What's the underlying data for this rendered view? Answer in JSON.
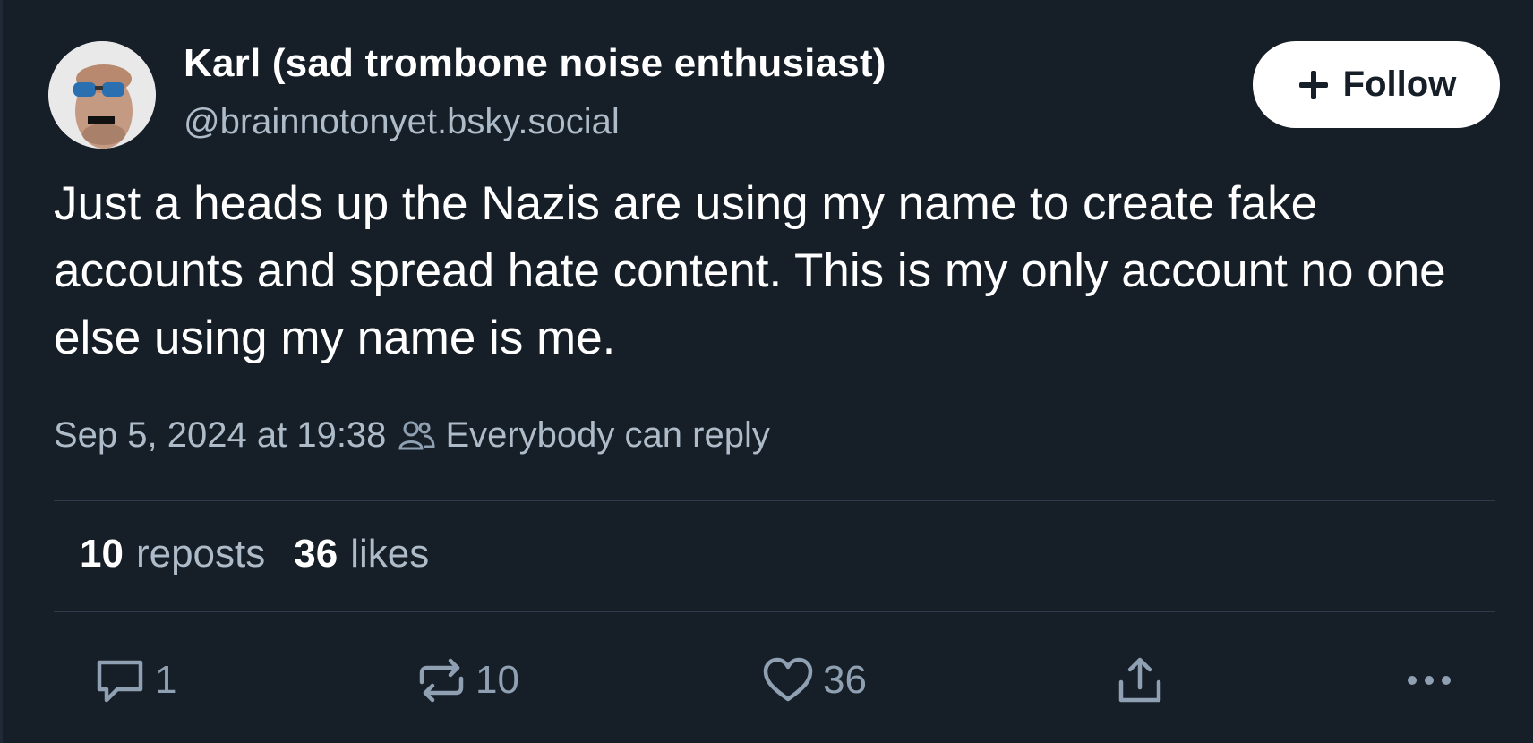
{
  "author": {
    "display_name": "Karl (sad trombone noise enthusiast)",
    "handle": "@brainnotonyet.bsky.social"
  },
  "follow_button": {
    "label": "Follow"
  },
  "post": {
    "text": "Just a heads up the Nazis are using my name to create fake accounts and spread hate content. This is my only account no one else using my name is me.",
    "timestamp": "Sep 5, 2024 at 19:38",
    "reply_setting": "Everybody can reply"
  },
  "stats": {
    "reposts_count": "10",
    "reposts_label": "reposts",
    "likes_count": "36",
    "likes_label": "likes"
  },
  "actions": {
    "reply_count": "1",
    "repost_count": "10",
    "like_count": "36"
  },
  "colors": {
    "background": "#161e27",
    "text_primary": "#ffffff",
    "text_secondary": "#aebbc9",
    "icon": "#8fa0b2",
    "divider": "#2e3b4a"
  },
  "icons": {
    "follow": "plus-icon",
    "reply_setting": "people-icon",
    "reply": "comment-icon",
    "repost": "repost-icon",
    "like": "heart-icon",
    "share": "share-icon",
    "more": "ellipsis-icon"
  }
}
